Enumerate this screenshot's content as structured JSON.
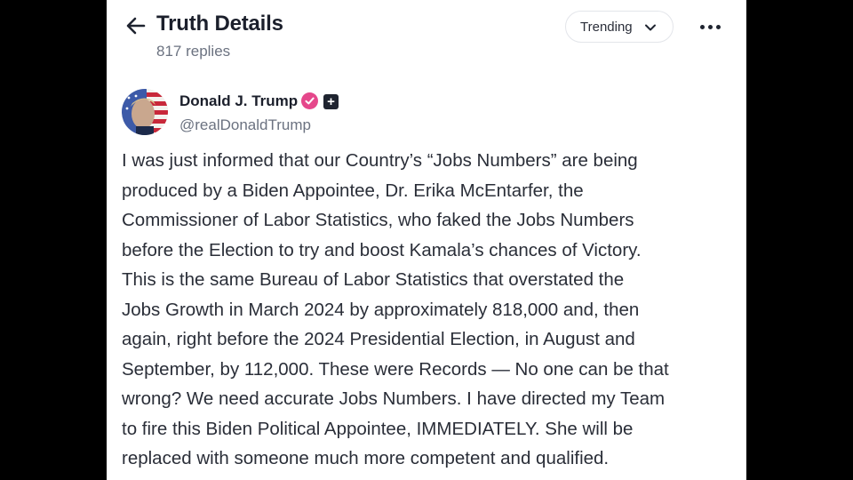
{
  "header": {
    "title": "Truth Details",
    "replies": "817 replies",
    "sort_label": "Trending",
    "back_icon": "arrow-left-icon",
    "more_icon": "more-horizontal-icon"
  },
  "author": {
    "name": "Donald J. Trump",
    "handle": "@realDonaldTrump",
    "verified_color": "#e5478b"
  },
  "post": {
    "lines": [
      "I was just informed that our Country’s “Jobs Numbers” are being",
      "produced by a Biden Appointee, Dr. Erika McEntarfer, the",
      "Commissioner of Labor Statistics, who faked the Jobs Numbers",
      "before the Election to try and boost Kamala’s chances of Victory.",
      "This is the same Bureau of Labor Statistics that overstated the",
      "Jobs Growth in March 2024 by approximately 818,000 and, then",
      "again, right before the 2024 Presidential Election, in August and",
      "September, by 112,000. These were Records — No one can be that",
      "wrong? We need accurate Jobs Numbers. I have directed my Team",
      "to fire this Biden Political Appointee, IMMEDIATELY. She will be",
      "replaced with someone much more competent and qualified."
    ]
  }
}
